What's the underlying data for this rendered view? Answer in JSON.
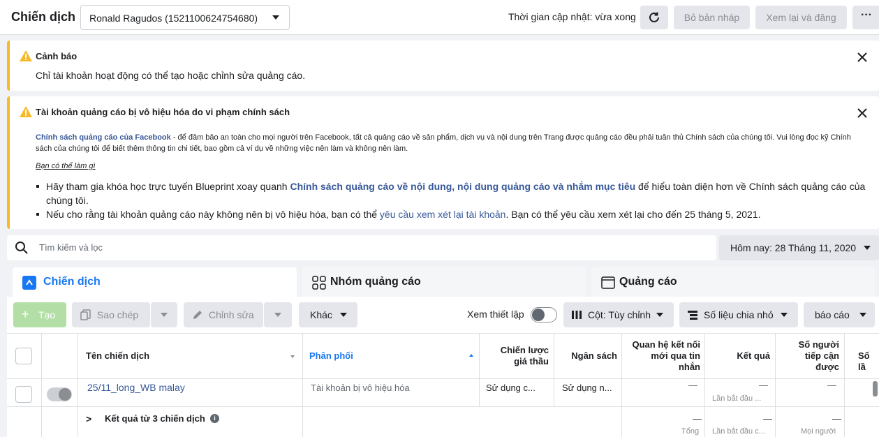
{
  "header": {
    "title": "Chiến dịch",
    "account": "Ronald Ragudos (1521100624754680)",
    "update_text": "Thời gian cập nhật: vừa xong",
    "discard_label": "Bỏ bản nháp",
    "review_label": "Xem lại và đăng",
    "more_label": "···"
  },
  "alerts": [
    {
      "title": "Cảnh báo",
      "body": "Chỉ tài khoản hoạt động có thể tạo hoặc chỉnh sửa quảng cáo."
    },
    {
      "title": "Tài khoản quảng cáo bị vô hiệu hóa do vi phạm chính sách",
      "policy_link": "Chính sách quảng cáo của Facebook",
      "policy_text": " - để đảm bảo an toàn cho mọi người trên Facebook, tất cả quảng cáo về sản phẩm, dịch vụ và nội dung trên Trang được quảng cáo đều phải tuân thủ Chính sách của chúng tôi. Vui lòng đọc kỹ Chính sách của chúng tôi để biết thêm thông tin chi tiết, bao gồm cả ví dụ về những việc nên làm và không nên làm.",
      "todo_label": "Bạn có thể làm gì",
      "bullet1_pre": "Hãy tham gia khóa học trực tuyến Blueprint xoay quanh ",
      "bullet1_link": "Chính sách quảng cáo về nội dung, nội dung quảng cáo và nhắm mục tiêu",
      "bullet1_post": " để hiểu toàn diện hơn về Chính sách quảng cáo của chúng tôi.",
      "bullet2_pre": "Nếu cho rằng tài khoản quảng cáo này không nên bị vô hiệu hóa, bạn có thể ",
      "bullet2_link": "yêu cầu xem xét lại tài khoản",
      "bullet2_post": ". Bạn có thể yêu cầu xem xét lại cho đến 25 tháng 5, 2021."
    }
  ],
  "search": {
    "placeholder": "Tìm kiếm và lọc",
    "date": "Hôm nay: 28 Tháng 11, 2020"
  },
  "tabs": [
    {
      "label": "Chiến dịch"
    },
    {
      "label": "Nhóm quảng cáo"
    },
    {
      "label": "Quảng cáo"
    }
  ],
  "toolbar": {
    "create": "Tạo",
    "copy": "Sao chép",
    "edit": "Chỉnh sửa",
    "other": "Khác",
    "view_setup": "Xem thiết lập",
    "columns": "Cột: Tùy chỉnh",
    "breakdown": "Số liệu chia nhỏ",
    "reports": "báo cáo"
  },
  "table": {
    "headers": {
      "name": "Tên chiến dịch",
      "delivery": "Phân phối",
      "bid_line1": "Chiến lược",
      "bid_line2": "giá thầu",
      "budget": "Ngân sách",
      "conv_line1": "Quan hệ kết nối",
      "conv_line2": "mới qua tin",
      "conv_line3": "nhắn",
      "results": "Kết quả",
      "reach_line1": "Số người",
      "reach_line2": "tiếp cận",
      "reach_line3": "được",
      "extra": "Số lầ"
    },
    "row": {
      "name": "25/11_long_WB malay",
      "delivery": "Tài khoản bị vô hiệu hóa",
      "bid": "Sử dụng c...",
      "budget": "Sử dụng n...",
      "conv": "—",
      "results": "—",
      "results_sub": "Lần bắt đầu ...",
      "reach": "—"
    },
    "summary": {
      "label": "Kết quả từ 3 chiến dịch",
      "conv": "—",
      "conv_sub": "Tổng",
      "results": "—",
      "results_sub": "Lần bắt đầu c...",
      "reach": "—",
      "reach_sub": "Mọi người"
    }
  }
}
